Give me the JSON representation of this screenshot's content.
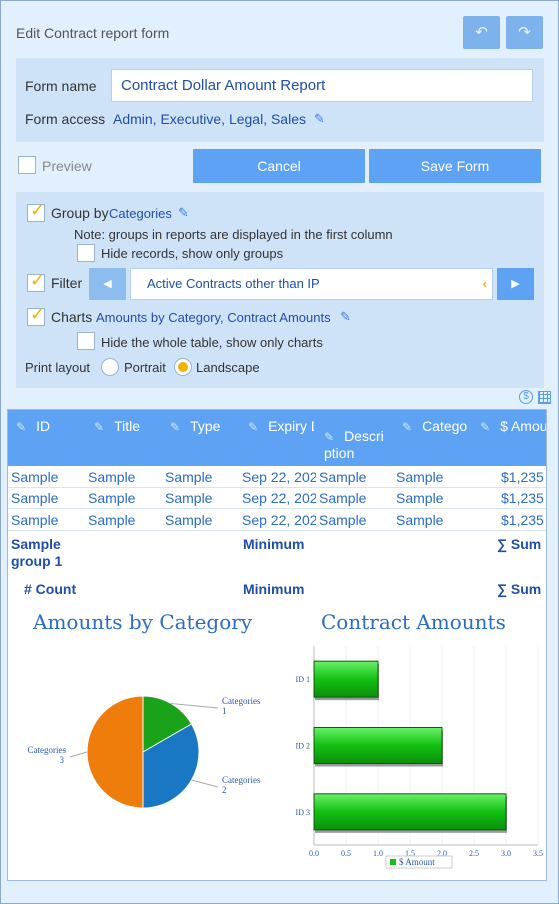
{
  "header": {
    "title": "Edit Contract report form",
    "undo_icon": "undo-icon",
    "redo_icon": "redo-icon"
  },
  "form": {
    "name_label": "Form name",
    "name_value": "Contract Dollar Amount Report",
    "access_label": "Form access",
    "access_value": "Admin, Executive, Legal, Sales"
  },
  "actions": {
    "preview_label": "Preview",
    "cancel_label": "Cancel",
    "save_label": "Save Form"
  },
  "options": {
    "group_by_label": "Group by",
    "group_by_value": "Categories",
    "group_note": "Note: groups in reports are displayed in the first column",
    "hide_records_label": "Hide records, show only groups",
    "filter_label": "Filter",
    "filter_value": "Active Contracts other than IP",
    "charts_label": "Charts",
    "charts_value": "Amounts by Category, Contract Amounts",
    "hide_table_label": "Hide the whole table, show only charts",
    "print_layout_label": "Print layout",
    "portrait_label": "Portrait",
    "landscape_label": "Landscape"
  },
  "table": {
    "columns": [
      "ID",
      "Title",
      "Type",
      "Expiry D",
      "Descri ption",
      "Catego",
      "$ Amou"
    ],
    "rows": [
      [
        "Sample",
        "Sample",
        "Sample",
        "Sep 22, 202",
        "Sample",
        "Sample",
        "$1,235"
      ],
      [
        "Sample",
        "Sample",
        "Sample",
        "Sep 22, 202",
        "Sample",
        "Sample",
        "$1,235"
      ],
      [
        "Sample",
        "Sample",
        "Sample",
        "Sep 22, 202",
        "Sample",
        "Sample",
        "$1,235"
      ]
    ],
    "group_label": "Sample group 1",
    "minimum_label": "Minimum",
    "sum_label": "∑ Sum",
    "count_label": "# Count"
  },
  "chart_data": [
    {
      "type": "pie",
      "title": "Amounts by Category",
      "slices": [
        {
          "label": "Categories 1",
          "value": 1,
          "color": "#1aa31a"
        },
        {
          "label": "Categories 2",
          "value": 2,
          "color": "#1a77c4"
        },
        {
          "label": "Categories 3",
          "value": 3,
          "color": "#ee7d0c"
        }
      ]
    },
    {
      "type": "bar",
      "orientation": "horizontal",
      "title": "Contract Amounts",
      "categories": [
        "ID 1",
        "ID 2",
        "ID 3"
      ],
      "series": [
        {
          "name": "$ Amount",
          "values": [
            1.0,
            2.0,
            3.0
          ],
          "color": "#19c019"
        }
      ],
      "xlim": [
        0,
        3.5
      ],
      "xticks": [
        "0.0",
        "0.5",
        "1.0",
        "1.5",
        "2.0",
        "2.5",
        "3.0",
        "3.5"
      ],
      "legend_position": "bottom"
    }
  ]
}
